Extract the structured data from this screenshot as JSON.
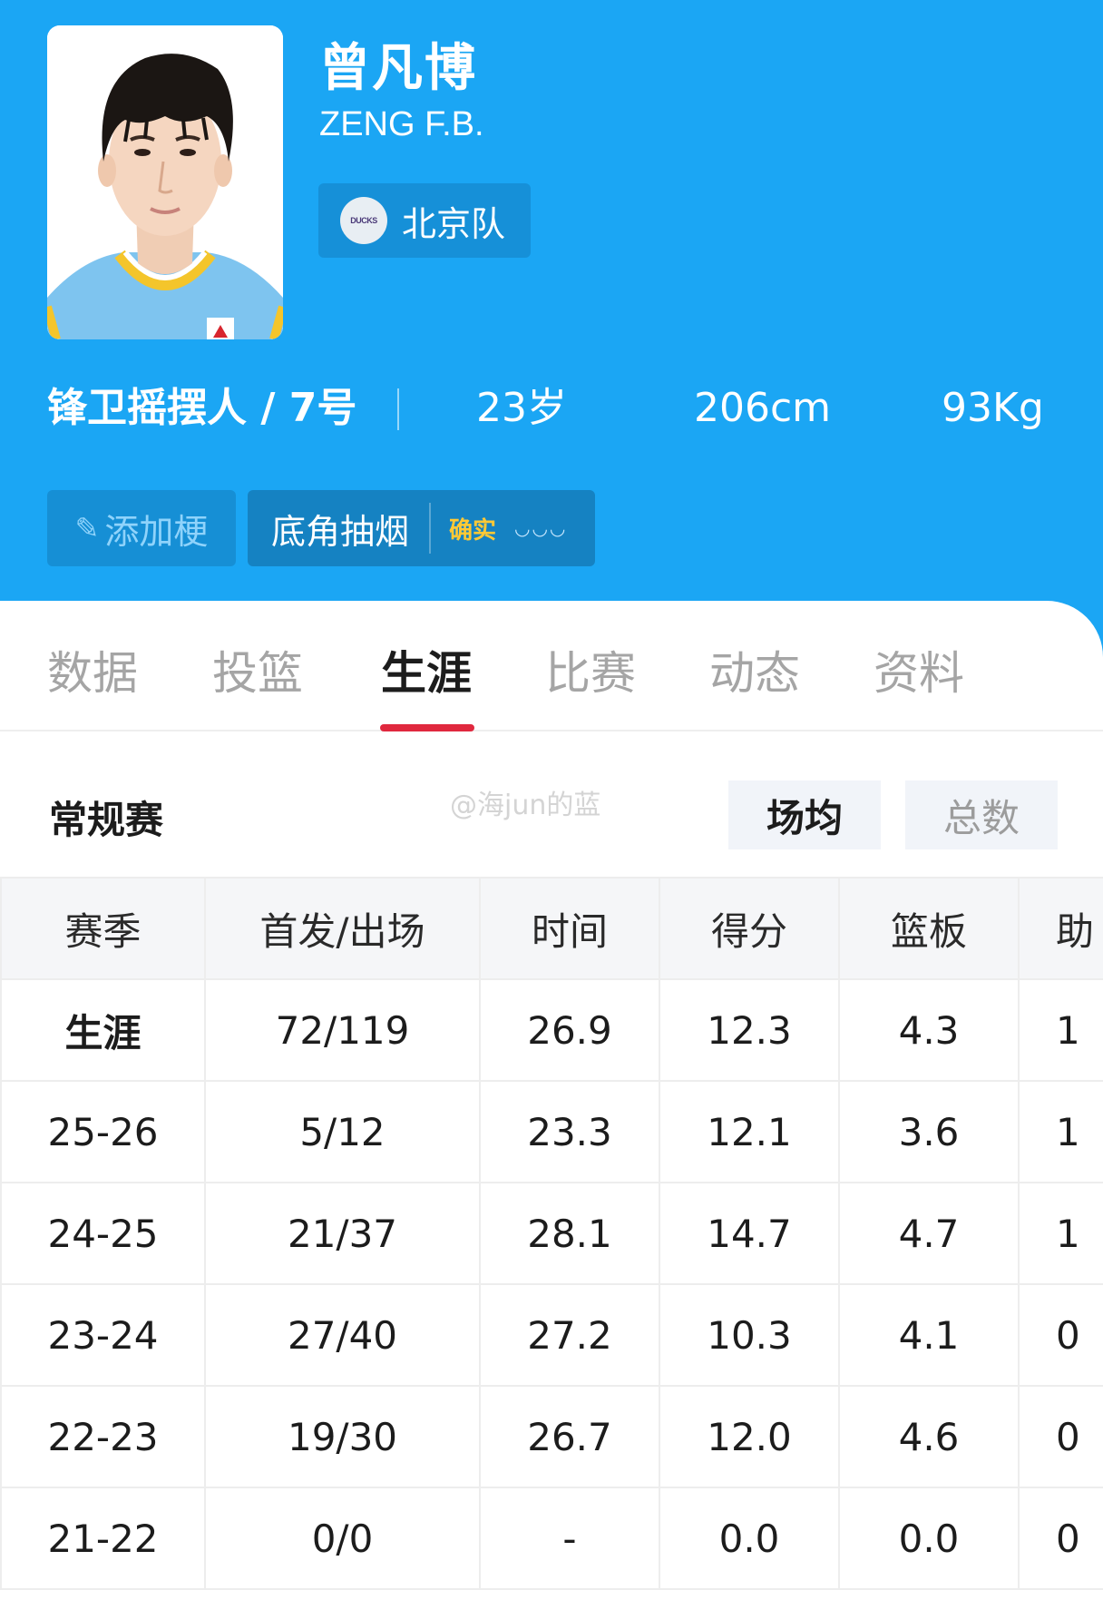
{
  "player": {
    "name_cn": "曾凡博",
    "name_en": "ZENG F.B.",
    "team_logo_text": "DUCKS",
    "team_name": "北京队",
    "position_number": "锋卫摇摆人 / 7号",
    "age": "23岁",
    "height": "206cm",
    "weight": "93Kg"
  },
  "tags": {
    "add_label": "添加梗",
    "meme_text": "底角抽烟",
    "confirm_label": "确实",
    "waves": "◡◡◡"
  },
  "tabs": [
    "数据",
    "投篮",
    "生涯",
    "比赛",
    "动态",
    "资料"
  ],
  "active_tab": "生涯",
  "section": {
    "title": "常规赛",
    "watermark": "@海jun的蓝",
    "toggle_avg": "场均",
    "toggle_total": "总数"
  },
  "table": {
    "headers": [
      "赛季",
      "首发/出场",
      "时间",
      "得分",
      "篮板",
      "助"
    ],
    "rows": [
      [
        "生涯",
        "72/119",
        "26.9",
        "12.3",
        "4.3",
        "1"
      ],
      [
        "25-26",
        "5/12",
        "23.3",
        "12.1",
        "3.6",
        "1"
      ],
      [
        "24-25",
        "21/37",
        "28.1",
        "14.7",
        "4.7",
        "1"
      ],
      [
        "23-24",
        "27/40",
        "27.2",
        "10.3",
        "4.1",
        "0"
      ],
      [
        "22-23",
        "19/30",
        "26.7",
        "12.0",
        "4.6",
        "0"
      ],
      [
        "21-22",
        "0/0",
        "-",
        "0.0",
        "0.0",
        "0"
      ]
    ]
  },
  "colors": {
    "header_bg": "#1ba6f4",
    "accent_red": "#e0283e"
  }
}
